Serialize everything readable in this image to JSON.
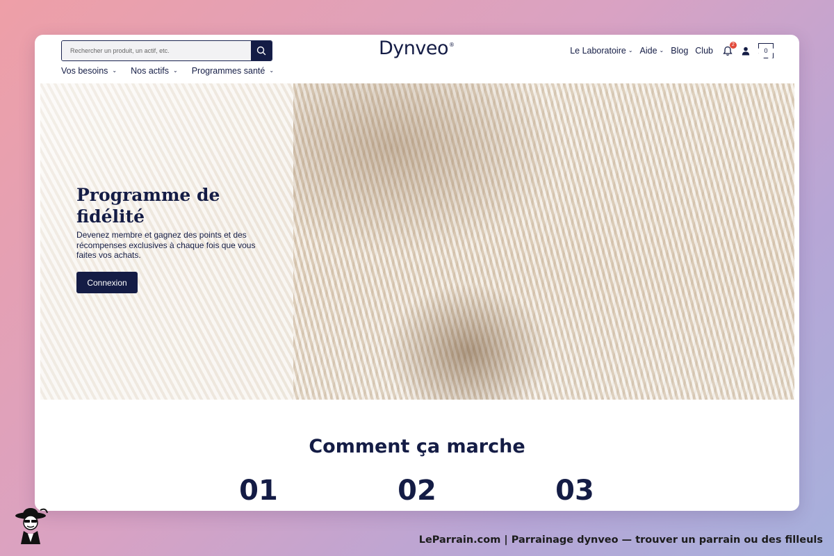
{
  "header": {
    "search": {
      "placeholder": "Rechercher un produit, un actif, etc."
    },
    "logo": {
      "text": "Dynveo",
      "mark": "®"
    },
    "nav_right": {
      "laboratoire": "Le Laboratoire",
      "aide": "Aide",
      "blog": "Blog",
      "club": "Club",
      "notifications_count": "2",
      "cart_count": "0"
    },
    "subnav": [
      "Vos besoins",
      "Nos actifs",
      "Programmes santé"
    ]
  },
  "hero": {
    "title": "Programme de fidélité",
    "description": "Devenez membre et gagnez des points et des récompenses exclusives à chaque fois que vous faites vos achats.",
    "button": "Connexion"
  },
  "how_it_works": {
    "title": "Comment ça marche",
    "steps": [
      "01",
      "02",
      "03"
    ]
  },
  "footer": {
    "caption": "LeParrain.com | Parrainage dynveo — trouver un parrain ou des filleuls"
  },
  "colors": {
    "navy": "#141c45",
    "badge": "#e24a3b"
  }
}
